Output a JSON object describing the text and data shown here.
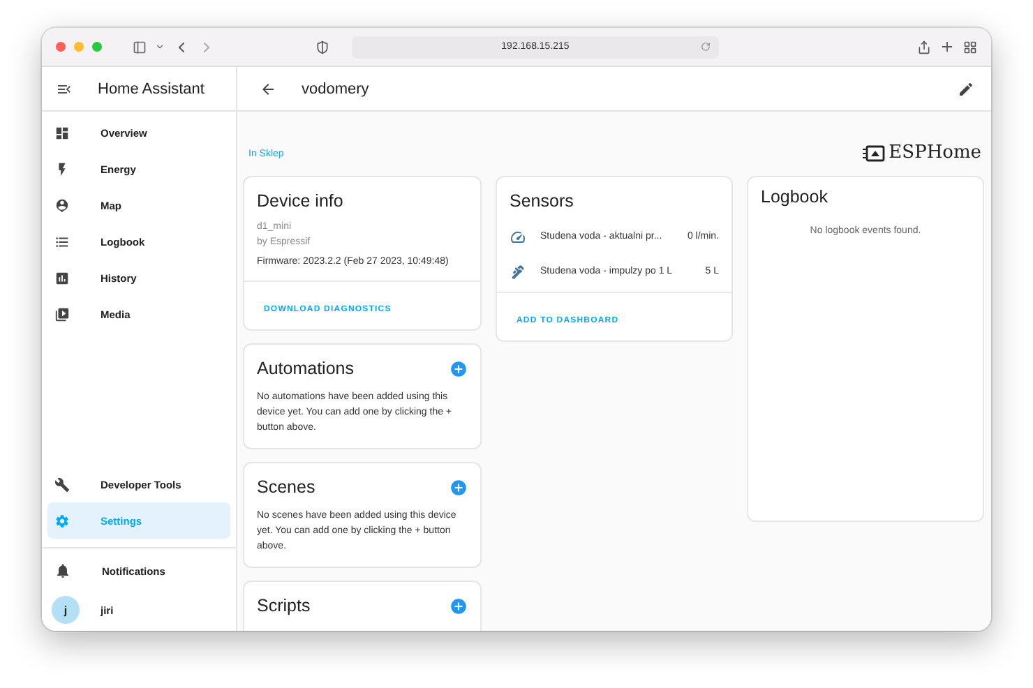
{
  "browser": {
    "url": "192.168.15.215"
  },
  "sidebar": {
    "title": "Home Assistant",
    "items": [
      {
        "label": "Overview",
        "selected": false
      },
      {
        "label": "Energy",
        "selected": false
      },
      {
        "label": "Map",
        "selected": false
      },
      {
        "label": "Logbook",
        "selected": false
      },
      {
        "label": "History",
        "selected": false
      },
      {
        "label": "Media",
        "selected": false
      }
    ],
    "bottom_items": [
      {
        "label": "Developer Tools",
        "selected": false
      },
      {
        "label": "Settings",
        "selected": true
      }
    ],
    "notifications": "Notifications",
    "user": {
      "initial": "j",
      "name": "jiri"
    }
  },
  "header": {
    "title": "vodomery"
  },
  "breadcrumb": "In Sklep",
  "brand": "ESPHome",
  "device_info": {
    "title": "Device info",
    "model": "d1_mini",
    "manufacturer": "by Espressif",
    "firmware": "Firmware: 2023.2.2 (Feb 27 2023, 10:49:48)",
    "action": "DOWNLOAD DIAGNOSTICS"
  },
  "sections": [
    {
      "title": "Automations",
      "message": "No automations have been added using this device yet. You can add one by clicking the + button above."
    },
    {
      "title": "Scenes",
      "message": "No scenes have been added using this device yet. You can add one by clicking the + button above."
    },
    {
      "title": "Scripts"
    }
  ],
  "sensors": {
    "title": "Sensors",
    "rows": [
      {
        "kind": "gauge",
        "name": "Studena voda - aktualni pr...",
        "value": "0 l/min."
      },
      {
        "kind": "pump",
        "name": "Studena voda - impulzy po 1 L",
        "value": "5 L"
      }
    ],
    "action": "ADD TO DASHBOARD"
  },
  "logbook": {
    "title": "Logbook",
    "message": "No logbook events found."
  }
}
